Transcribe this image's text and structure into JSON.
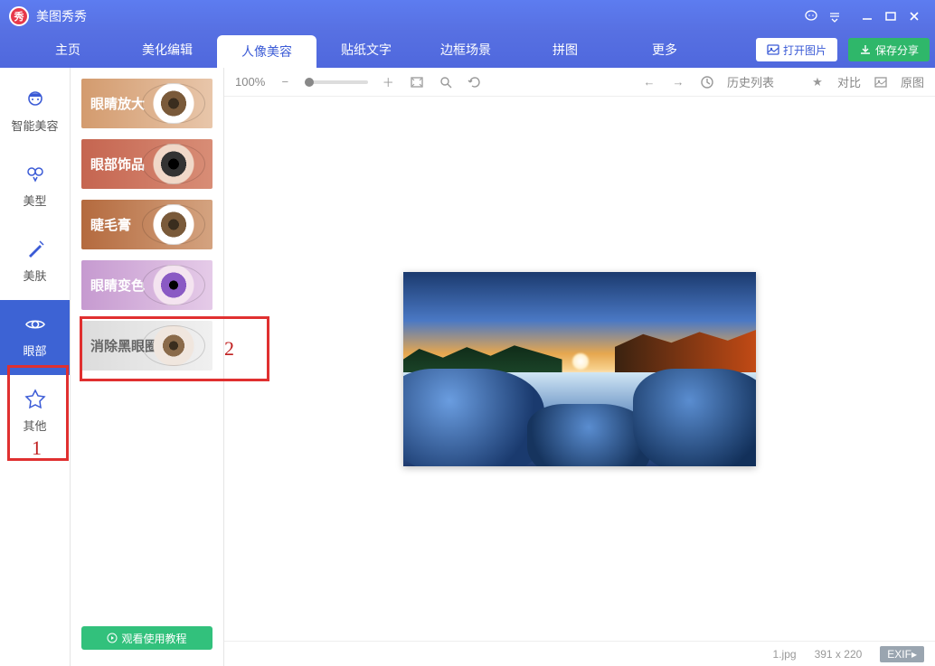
{
  "app": {
    "name": "美图秀秀"
  },
  "titlebar": {
    "chat": "●",
    "menu": "≡"
  },
  "tabs": [
    {
      "label": "主页"
    },
    {
      "label": "美化编辑"
    },
    {
      "label": "人像美容"
    },
    {
      "label": "贴纸文字"
    },
    {
      "label": "边框场景"
    },
    {
      "label": "拼图"
    },
    {
      "label": "更多"
    }
  ],
  "active_tab": 2,
  "buttons": {
    "open": "打开图片",
    "save": "保存分享"
  },
  "sidebar": [
    {
      "label": "智能美容"
    },
    {
      "label": "美型"
    },
    {
      "label": "美肤"
    },
    {
      "label": "眼部"
    },
    {
      "label": "其他"
    }
  ],
  "active_side": 3,
  "sub_items": [
    {
      "label": "眼睛放大"
    },
    {
      "label": "眼部饰品"
    },
    {
      "label": "睫毛膏"
    },
    {
      "label": "眼睛变色"
    },
    {
      "label": "消除黑眼圈"
    }
  ],
  "tutorial": "观看使用教程",
  "toolbar": {
    "zoom": "100%",
    "history": "历史列表",
    "compare": "对比",
    "original": "原图"
  },
  "status": {
    "filename": "1.jpg",
    "dims": "391 x 220",
    "exif": "EXIF▸"
  },
  "annotations": {
    "a1": "1",
    "a2": "2"
  }
}
